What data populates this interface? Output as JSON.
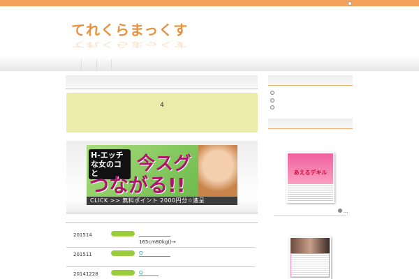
{
  "site": {
    "title": "てれくらまっくす"
  },
  "notice": {
    "text": "4"
  },
  "banner": {
    "tag": "H-エッチな女のコと",
    "headline1": "今スグ",
    "headline2": "つながる!!",
    "cta": "CLICK >> 無料ポイント 2000円分☆進呈"
  },
  "news": [
    {
      "date": "201514",
      "link": "",
      "desc": "165cm80kg()→"
    },
    {
      "date": "201511",
      "link": "Q",
      "desc": ""
    },
    {
      "date": "20141228",
      "link": "Q",
      "desc": ""
    }
  ],
  "sidebar": {
    "ad1_text": "あえるデキル",
    "more": "..."
  },
  "colors": {
    "accent": "#f5a25d",
    "pill": "#9bcc3c",
    "notice": "#ecebaa"
  }
}
